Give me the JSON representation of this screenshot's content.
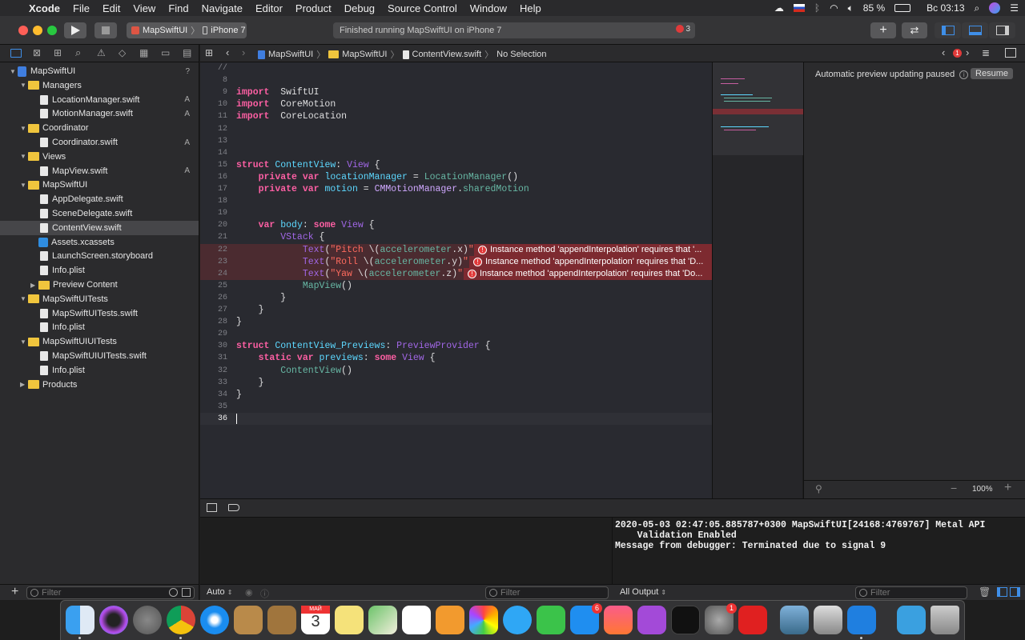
{
  "menubar": {
    "items": [
      "Xcode",
      "File",
      "Edit",
      "View",
      "Find",
      "Navigate",
      "Editor",
      "Product",
      "Debug",
      "Source Control",
      "Window",
      "Help"
    ],
    "battery": "85 %",
    "clock": "Вс 03:13"
  },
  "toolbar": {
    "scheme": "MapSwiftUI",
    "device": "iPhone 7",
    "status": "Finished running MapSwiftUI on iPhone 7",
    "error_count": "3"
  },
  "navigator": {
    "rows": [
      {
        "label": "MapSwiftUI",
        "icon": "project",
        "indent": 0,
        "open": true,
        "badge": "?"
      },
      {
        "label": "Managers",
        "icon": "folder",
        "indent": 1,
        "open": true,
        "badge": ""
      },
      {
        "label": "LocationManager.swift",
        "icon": "file",
        "indent": 2,
        "badge": "A"
      },
      {
        "label": "MotionManager.swift",
        "icon": "file",
        "indent": 2,
        "badge": "A"
      },
      {
        "label": "Coordinator",
        "icon": "folder",
        "indent": 1,
        "open": true,
        "badge": ""
      },
      {
        "label": "Coordinator.swift",
        "icon": "file",
        "indent": 2,
        "badge": "A"
      },
      {
        "label": "Views",
        "icon": "folder",
        "indent": 1,
        "open": true,
        "badge": ""
      },
      {
        "label": "MapView.swift",
        "icon": "file",
        "indent": 2,
        "badge": "A"
      },
      {
        "label": "MapSwiftUI",
        "icon": "folder",
        "indent": 1,
        "open": true,
        "badge": ""
      },
      {
        "label": "AppDelegate.swift",
        "icon": "file",
        "indent": 2,
        "badge": ""
      },
      {
        "label": "SceneDelegate.swift",
        "icon": "file",
        "indent": 2,
        "badge": ""
      },
      {
        "label": "ContentView.swift",
        "icon": "file",
        "indent": 2,
        "badge": "",
        "selected": true
      },
      {
        "label": "Assets.xcassets",
        "icon": "asset",
        "indent": 2,
        "badge": ""
      },
      {
        "label": "LaunchScreen.storyboard",
        "icon": "file",
        "indent": 2,
        "badge": ""
      },
      {
        "label": "Info.plist",
        "icon": "file",
        "indent": 2,
        "badge": ""
      },
      {
        "label": "Preview Content",
        "icon": "folder",
        "indent": 2,
        "open": false,
        "badge": ""
      },
      {
        "label": "MapSwiftUITests",
        "icon": "folder",
        "indent": 1,
        "open": true,
        "badge": ""
      },
      {
        "label": "MapSwiftUITests.swift",
        "icon": "file",
        "indent": 2,
        "badge": ""
      },
      {
        "label": "Info.plist",
        "icon": "file",
        "indent": 2,
        "badge": ""
      },
      {
        "label": "MapSwiftUIUITests",
        "icon": "folder",
        "indent": 1,
        "open": true,
        "badge": ""
      },
      {
        "label": "MapSwiftUIUITests.swift",
        "icon": "file",
        "indent": 2,
        "badge": ""
      },
      {
        "label": "Info.plist",
        "icon": "file",
        "indent": 2,
        "badge": ""
      },
      {
        "label": "Products",
        "icon": "folder",
        "indent": 1,
        "open": false,
        "badge": ""
      }
    ],
    "filter_placeholder": "Filter"
  },
  "jumpbar": {
    "crumbs": [
      "MapSwiftUI",
      "MapSwiftUI",
      "ContentView.swift",
      "No Selection"
    ],
    "error_count": "1"
  },
  "editor": {
    "lines": [
      {
        "n": "//",
        "tokens": []
      },
      {
        "n": "8",
        "tokens": []
      },
      {
        "n": "9",
        "tokens": [
          [
            "kw",
            "import"
          ],
          [
            "",
            "  SwiftUI"
          ]
        ]
      },
      {
        "n": "10",
        "tokens": [
          [
            "kw",
            "import"
          ],
          [
            "",
            "  CoreMotion"
          ]
        ]
      },
      {
        "n": "11",
        "tokens": [
          [
            "kw",
            "import"
          ],
          [
            "",
            "  CoreLocation"
          ]
        ]
      },
      {
        "n": "12",
        "tokens": []
      },
      {
        "n": "13",
        "tokens": []
      },
      {
        "n": "14",
        "tokens": []
      },
      {
        "n": "15",
        "tokens": [
          [
            "kw",
            "struct"
          ],
          [
            "",
            " "
          ],
          [
            "tn",
            "ContentView"
          ],
          [
            "",
            ": "
          ],
          [
            "ty2",
            "View"
          ],
          [
            "",
            " {"
          ]
        ]
      },
      {
        "n": "16",
        "tokens": [
          [
            "",
            "    "
          ],
          [
            "kw",
            "private var"
          ],
          [
            "",
            " "
          ],
          [
            "tn",
            "locationManager"
          ],
          [
            "",
            " = "
          ],
          [
            "id",
            "LocationManager"
          ],
          [
            "",
            "()"
          ]
        ]
      },
      {
        "n": "17",
        "tokens": [
          [
            "",
            "    "
          ],
          [
            "kw",
            "private var"
          ],
          [
            "",
            " "
          ],
          [
            "tn",
            "motion"
          ],
          [
            "",
            " = "
          ],
          [
            "ty",
            "CMMotionManager"
          ],
          [
            "",
            "."
          ],
          [
            "id",
            "sharedMotion"
          ]
        ]
      },
      {
        "n": "18",
        "tokens": []
      },
      {
        "n": "19",
        "tokens": []
      },
      {
        "n": "20",
        "tokens": [
          [
            "",
            "    "
          ],
          [
            "kw",
            "var"
          ],
          [
            "",
            " "
          ],
          [
            "tn",
            "body"
          ],
          [
            "",
            ": "
          ],
          [
            "kw",
            "some"
          ],
          [
            "",
            " "
          ],
          [
            "ty2",
            "View"
          ],
          [
            "",
            " {"
          ]
        ]
      },
      {
        "n": "21",
        "tokens": [
          [
            "",
            "        "
          ],
          [
            "ty2",
            "VStack"
          ],
          [
            "",
            " {"
          ]
        ]
      },
      {
        "n": "22",
        "tokens": [
          [
            "",
            "            "
          ],
          [
            "ty2",
            "Text"
          ],
          [
            "",
            "("
          ],
          [
            "str",
            "\"Pitch "
          ],
          [
            "",
            "\\("
          ],
          [
            "id",
            "accelerometer"
          ],
          [
            "",
            ".x)"
          ],
          [
            "str",
            "\""
          ],
          [
            "",
            ")"
          ]
        ],
        "error": "Instance method 'appendInterpolation' requires that '..."
      },
      {
        "n": "23",
        "tokens": [
          [
            "",
            "            "
          ],
          [
            "ty2",
            "Text"
          ],
          [
            "",
            "("
          ],
          [
            "str",
            "\"Roll "
          ],
          [
            "",
            "\\("
          ],
          [
            "id",
            "accelerometer"
          ],
          [
            "",
            ".y)"
          ],
          [
            "str",
            "\""
          ],
          [
            "",
            ")"
          ]
        ],
        "error": "Instance method 'appendInterpolation' requires that 'D..."
      },
      {
        "n": "24",
        "tokens": [
          [
            "",
            "            "
          ],
          [
            "ty2",
            "Text"
          ],
          [
            "",
            "("
          ],
          [
            "str",
            "\"Yaw "
          ],
          [
            "",
            "\\("
          ],
          [
            "id",
            "accelerometer"
          ],
          [
            "",
            ".z)"
          ],
          [
            "str",
            "\""
          ],
          [
            "",
            ")"
          ]
        ],
        "error": "Instance method 'appendInterpolation' requires that 'Do..."
      },
      {
        "n": "25",
        "tokens": [
          [
            "",
            "            "
          ],
          [
            "id",
            "MapView"
          ],
          [
            "",
            "()"
          ]
        ]
      },
      {
        "n": "26",
        "tokens": [
          [
            "",
            "        }"
          ]
        ]
      },
      {
        "n": "27",
        "tokens": [
          [
            "",
            "    }"
          ]
        ]
      },
      {
        "n": "28",
        "tokens": [
          [
            "",
            "}"
          ]
        ]
      },
      {
        "n": "29",
        "tokens": []
      },
      {
        "n": "30",
        "tokens": [
          [
            "kw",
            "struct"
          ],
          [
            "",
            " "
          ],
          [
            "tn",
            "ContentView_Previews"
          ],
          [
            "",
            ": "
          ],
          [
            "ty2",
            "PreviewProvider"
          ],
          [
            "",
            " {"
          ]
        ]
      },
      {
        "n": "31",
        "tokens": [
          [
            "",
            "    "
          ],
          [
            "kw",
            "static var"
          ],
          [
            "",
            " "
          ],
          [
            "tn",
            "previews"
          ],
          [
            "",
            ": "
          ],
          [
            "kw",
            "some"
          ],
          [
            "",
            " "
          ],
          [
            "ty2",
            "View"
          ],
          [
            "",
            " {"
          ]
        ]
      },
      {
        "n": "32",
        "tokens": [
          [
            "",
            "        "
          ],
          [
            "id",
            "ContentView"
          ],
          [
            "",
            "()"
          ]
        ]
      },
      {
        "n": "33",
        "tokens": [
          [
            "",
            "    }"
          ]
        ]
      },
      {
        "n": "34",
        "tokens": [
          [
            "",
            "}"
          ]
        ]
      },
      {
        "n": "35",
        "tokens": []
      },
      {
        "n": "36",
        "tokens": [],
        "current": true
      }
    ]
  },
  "preview": {
    "message": "Automatic preview updating paused",
    "resume": "Resume",
    "zoom": "100%"
  },
  "debug": {
    "auto_label": "Auto",
    "filter_placeholder": "Filter",
    "output_label": "All Output",
    "console": "2020-05-03 02:47:05.885787+0300 MapSwiftUI[24168:4769767] Metal API\n    Validation Enabled\nMessage from debugger: Terminated due to signal 9"
  },
  "dock": {
    "calendar_month": "МАЙ",
    "calendar_day": "3",
    "appstore_badge": "6",
    "prefs_badge": "1"
  },
  "colors": {
    "accent": "#3f7ee0",
    "error": "#e03a3a",
    "folder": "#f0c53d"
  }
}
